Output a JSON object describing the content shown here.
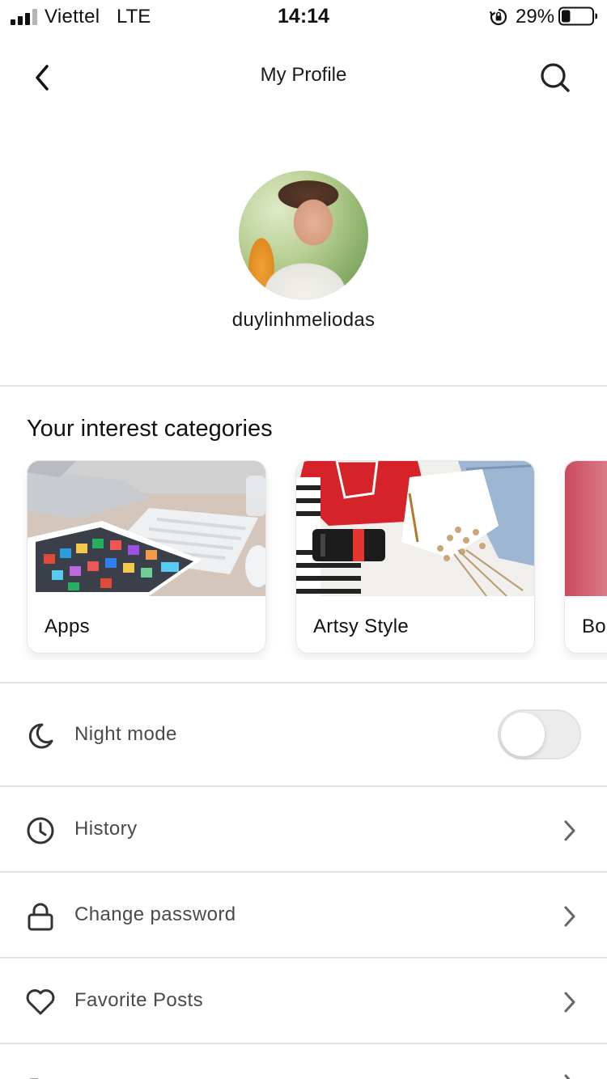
{
  "status_bar": {
    "carrier": "Viettel",
    "network": "LTE",
    "time": "14:14",
    "battery": "29%",
    "battery_level": 0.29,
    "icons": [
      "signal-icon",
      "orientation-lock-icon",
      "battery-icon"
    ]
  },
  "nav": {
    "title": "My Profile",
    "back_icon": "chevron-left-icon",
    "search_icon": "search-icon"
  },
  "profile": {
    "username": "duylinhmeliodas"
  },
  "interests": {
    "title": "Your interest categories",
    "cards": [
      {
        "label": "Apps"
      },
      {
        "label": "Artsy Style"
      },
      {
        "label": "Bo"
      }
    ]
  },
  "settings": {
    "night_mode": {
      "label": "Night mode",
      "icon": "moon-icon",
      "enabled": false
    },
    "items": [
      {
        "label": "History",
        "icon": "clock-icon"
      },
      {
        "label": "Change password",
        "icon": "lock-icon"
      },
      {
        "label": "Favorite Posts",
        "icon": "heart-icon"
      }
    ]
  },
  "colors": {
    "text_primary": "#1a1a1a",
    "text_secondary": "#4a4a4a",
    "divider": "#e4e4e4",
    "toggle_off": "#ececec"
  }
}
